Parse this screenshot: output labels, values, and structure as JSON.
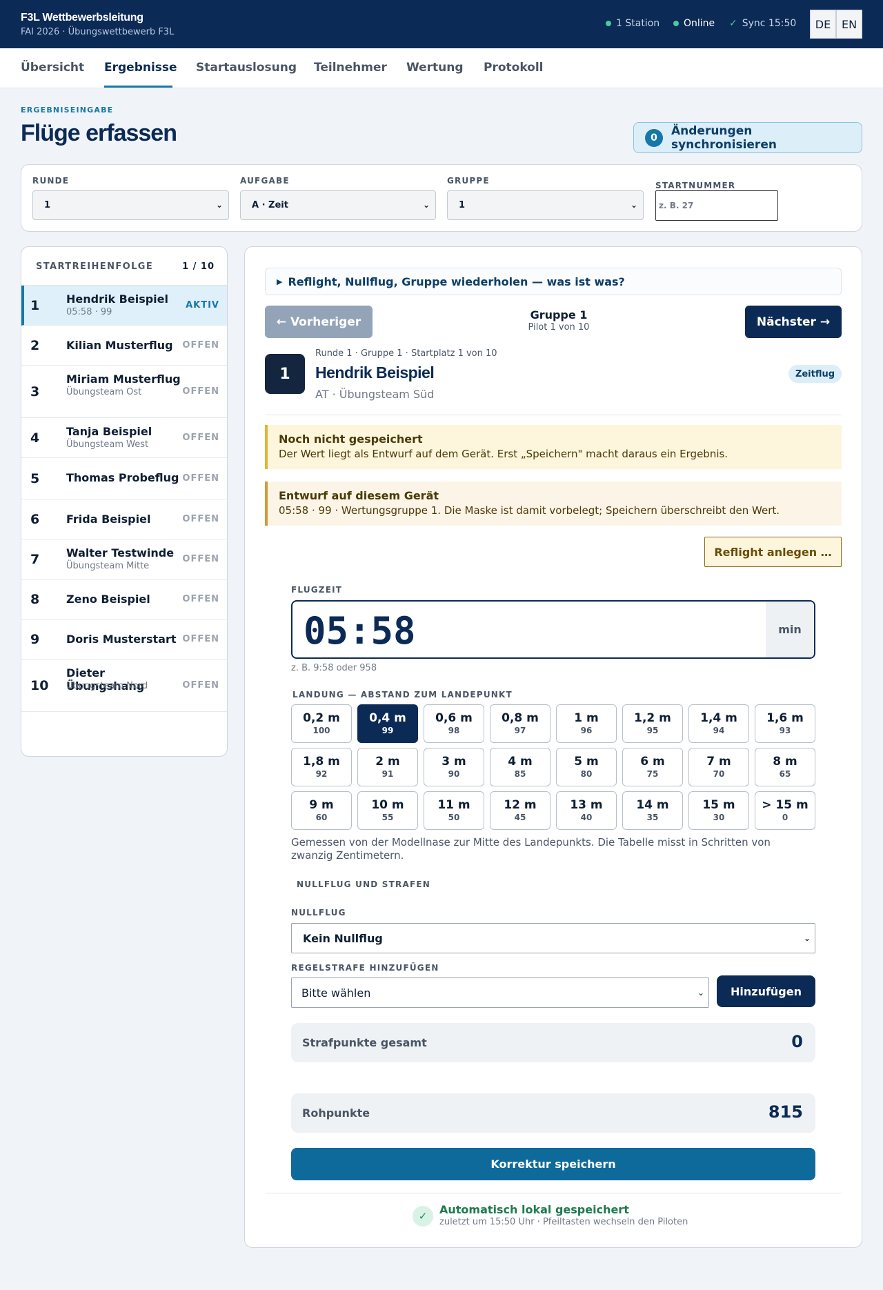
{
  "app": {
    "title": "F3L Wettbewerbsleitung",
    "subtitle": "FAI 2026 · Übungswettbewerb F3L",
    "status_station": "1 Station",
    "status_online": "Online",
    "status_sync": "Sync 15:50",
    "lang_de": "DE",
    "lang_en": "EN"
  },
  "nav": {
    "tabs": [
      "Übersicht",
      "Ergebnisse",
      "Startauslosung",
      "Teilnehmer",
      "Wertung",
      "Protokoll"
    ],
    "active": "Ergebnisse"
  },
  "page": {
    "eyebrow": "ERGEBNISEINGABE",
    "title": "Flüge erfassen",
    "sync_count": "0",
    "sync_label": "Änderungen synchronisieren"
  },
  "filters": {
    "round_label": "RUNDE",
    "round_value": "1",
    "task_label": "AUFGABE",
    "task_value": "A · Zeit",
    "group_label": "GRUPPE",
    "group_value": "1",
    "start_label": "STARTNUMMER",
    "start_placeholder": "z. B. 27"
  },
  "order": {
    "label": "STARTREIHENFOLGE",
    "count": "1 / 10",
    "rows": [
      {
        "num": "1",
        "name": "Hendrik Beispiel",
        "sub": "05:58 · 99",
        "status": "AKTIV"
      },
      {
        "num": "2",
        "name": "Kilian Musterflug",
        "sub": "",
        "status": "OFFEN"
      },
      {
        "num": "3",
        "name": "Miriam Musterflug",
        "sub": "Übungsteam Ost",
        "status": "OFFEN"
      },
      {
        "num": "4",
        "name": "Tanja Beispiel",
        "sub": "Übungsteam West",
        "status": "OFFEN"
      },
      {
        "num": "5",
        "name": "Thomas Probeflug",
        "sub": "",
        "status": "OFFEN"
      },
      {
        "num": "6",
        "name": "Frida Beispiel",
        "sub": "",
        "status": "OFFEN"
      },
      {
        "num": "7",
        "name": "Walter Testwinde",
        "sub": "Übungsteam Mitte",
        "status": "OFFEN"
      },
      {
        "num": "8",
        "name": "Zeno Beispiel",
        "sub": "",
        "status": "OFFEN"
      },
      {
        "num": "9",
        "name": "Doris Musterstart",
        "sub": "",
        "status": "OFFEN"
      },
      {
        "num": "10",
        "name": "Dieter Übungshang",
        "sub": "Übungsteam Nord",
        "status": "OFFEN"
      }
    ]
  },
  "main": {
    "help": "Reflight, Nullflug, Gruppe wiederholen — was ist was?",
    "prev": "← Vorheriger",
    "next": "Nächster →",
    "group_title": "Gruppe 1",
    "group_sub": "Pilot 1 von 10",
    "pilot_num": "1",
    "pilot_meta": "Runde 1 · Gruppe 1 · Startplatz 1 von 10",
    "pilot_name": "Hendrik Beispiel",
    "pilot_club": "AT · Übungsteam Süd",
    "chip": "Zeitflug",
    "alert1_title": "Noch nicht gespeichert",
    "alert1_text": "Der Wert liegt als Entwurf auf dem Gerät. Erst „Speichern\" macht daraus ein Ergebnis.",
    "alert2_title": "Entwurf auf diesem Gerät",
    "alert2_text": "05:58 · 99 · Wertungsgruppe 1. Die Maske ist damit vorbelegt; Speichern überschreibt den Wert.",
    "reflight": "Reflight anlegen …",
    "flight_label": "FLUGZEIT",
    "flight_value": "05:58",
    "flight_unit": "min",
    "flight_hint": "z. B. 9:58 oder 958",
    "landing_label": "LANDUNG — ABSTAND ZUM LANDEPUNKT",
    "landing": [
      {
        "d": "0,2 m",
        "p": "100"
      },
      {
        "d": "0,4 m",
        "p": "99"
      },
      {
        "d": "0,6 m",
        "p": "98"
      },
      {
        "d": "0,8 m",
        "p": "97"
      },
      {
        "d": "1 m",
        "p": "96"
      },
      {
        "d": "1,2 m",
        "p": "95"
      },
      {
        "d": "1,4 m",
        "p": "94"
      },
      {
        "d": "1,6 m",
        "p": "93"
      },
      {
        "d": "1,8 m",
        "p": "92"
      },
      {
        "d": "2 m",
        "p": "91"
      },
      {
        "d": "3 m",
        "p": "90"
      },
      {
        "d": "4 m",
        "p": "85"
      },
      {
        "d": "5 m",
        "p": "80"
      },
      {
        "d": "6 m",
        "p": "75"
      },
      {
        "d": "7 m",
        "p": "70"
      },
      {
        "d": "8 m",
        "p": "65"
      },
      {
        "d": "9 m",
        "p": "60"
      },
      {
        "d": "10 m",
        "p": "55"
      },
      {
        "d": "11 m",
        "p": "50"
      },
      {
        "d": "12 m",
        "p": "45"
      },
      {
        "d": "13 m",
        "p": "40"
      },
      {
        "d": "14 m",
        "p": "35"
      },
      {
        "d": "15 m",
        "p": "30"
      },
      {
        "d": "> 15 m",
        "p": "0"
      }
    ],
    "landing_selected": "0,4 m",
    "landing_note": "Gemessen von der Modellnase zur Mitte des Landepunkts. Die Tabelle misst in Schritten von zwanzig Zentimetern.",
    "penalty_section": "NULLFLUG UND STRAFEN",
    "null_label": "NULLFLUG",
    "null_value": "Kein Nullflug",
    "rule_label": "REGELSTRAFE HINZUFÜGEN",
    "rule_value": "Bitte wählen",
    "add": "Hinzufügen",
    "penalty_total_label": "Strafpunkte gesamt",
    "penalty_total_value": "0",
    "raw_label": "Rohpunkte",
    "raw_value": "815",
    "save": "Korrektur speichern",
    "auto_title": "Automatisch lokal gespeichert",
    "auto_sub": "zuletzt um 15:50 Uhr · Pfeiltasten wechseln den Piloten"
  },
  "colors": {
    "navy": "#0b2a55",
    "accent": "#1877a8",
    "success": "#1e7a50",
    "warning": "#e3b432"
  },
  "icons": {
    "status": "status-dot-icon",
    "sync": "check-icon",
    "help": "triangle-right-icon",
    "select": "chevron-down-icon"
  }
}
